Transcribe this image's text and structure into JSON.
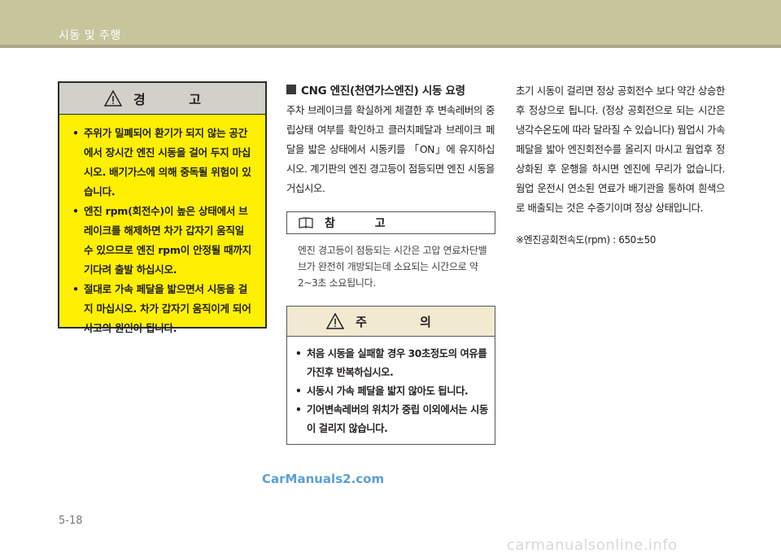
{
  "header": {
    "title": "시동 및 주행"
  },
  "warning": {
    "title": "경 고",
    "items": [
      "주위가 밀폐되어 환기가 되지 않는 공간에서 장시간 엔진 시동을 걸어 두지 마십시오. 배기가스에 의해 중독될 위험이 있습니다.",
      "엔진 rpm(회전수)이 높은 상태에서 브레이크를 해제하면 차가 갑자기 움직일 수 있으므로 엔진 rpm이 안정될 때까지 기다려 출발 하십시오.",
      "절대로 가속 페달을 밟으면서 시동을 걸지 마십시오. 차가 갑자기 움직이게 되어 사고의 원인이 됩니다."
    ]
  },
  "section": {
    "title": "CNG 엔진(천연가스엔진) 시동 요령",
    "body": "주차 브레이크를 확실하게 체결한 후 변속레버의 중립상태 여부를 확인하고 클러치페달과 브레이크 페달을 밟은 상태에서 시동키를 「ON」에 유지하십시오. 계기판의 엔진 경고등이 점등되면 엔진 시동을 거십시오."
  },
  "note": {
    "title": "참 고",
    "text": "엔진 경고등이 점등되는 시간은 고압 연료차단밸브가 완전히 개방되는데 소요되는 시간으로 약 2~3초 소요됩니다."
  },
  "caution": {
    "title": "주 의",
    "items": [
      "처음 시동을 실패할 경우 30초정도의 여유를 가진후 반복하십시오.",
      "시동시 가속 페달을 밟지 않아도 됩니다.",
      "기어변속레버의 위치가 중립 이외에서는 시동이 걸리지 않습니다."
    ]
  },
  "right_text": "초기 시동이 걸리면 정상 공회전수 보다 약간 상승한 후 정상으로 됩니다. (정상 공회전으로 되는 시간은 냉각수온도에 따라 달라질 수 있습니다) 웜업시 가속 페달을 밟아 엔진회전수를 올리지 마시고 웜업후 정상화된 후 운행을 하시면 엔진에 무리가 없습니다. 웜업 운전시 연소된 연료가 배기관을 통하여 흰색으로 배출되는 것은 수증기이며 정상 상태입니다.",
  "footnote": "※엔진공회전속도(rpm) : 650±50",
  "watermark": "CarManuals2.com",
  "page_number": "5-18",
  "bottom_watermark": "carmanualsonline.info"
}
